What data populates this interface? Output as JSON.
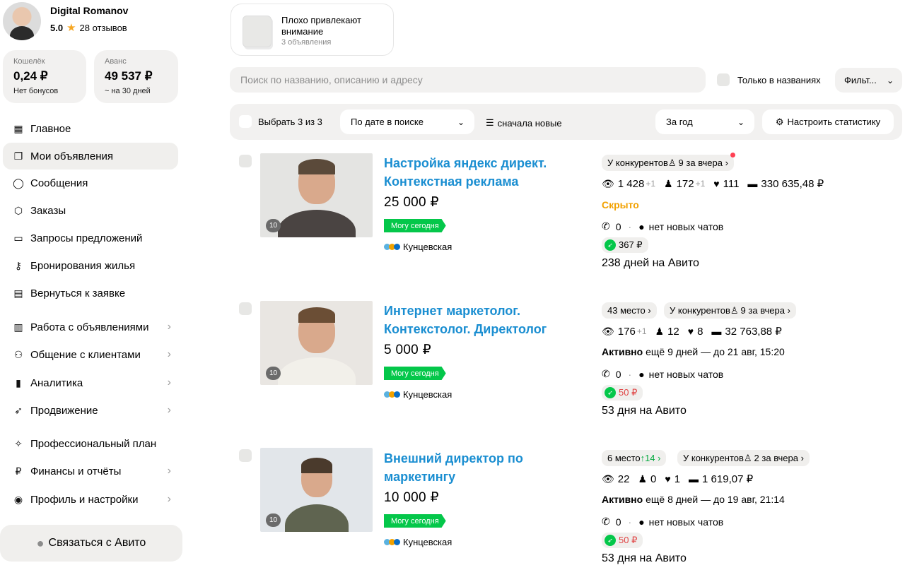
{
  "profile": {
    "name": "Digital Romanov",
    "rating": "5.0",
    "reviews": "28 отзывов"
  },
  "wallet": {
    "label": "Кошелёк",
    "value": "0,24 ₽",
    "sub": "Нет бонусов"
  },
  "advance": {
    "label": "Аванс",
    "value": "49 537 ₽",
    "sub": "~ на 30 дней"
  },
  "nav": [
    {
      "label": "Главное"
    },
    {
      "label": "Мои объявления"
    },
    {
      "label": "Сообщения"
    },
    {
      "label": "Заказы"
    },
    {
      "label": "Запросы предложений"
    },
    {
      "label": "Бронирования жилья"
    },
    {
      "label": "Вернуться к заявке"
    },
    {
      "label": "Работа с объявлениями"
    },
    {
      "label": "Общение с клиентами"
    },
    {
      "label": "Аналитика"
    },
    {
      "label": "Продвижение"
    },
    {
      "label": "Профессиональный план"
    },
    {
      "label": "Финансы и отчёты"
    },
    {
      "label": "Профиль и настройки"
    }
  ],
  "contact_label": "Связаться с Авито",
  "promo": {
    "title": "Плохо привлекают внимание",
    "sub": "3 объявления"
  },
  "search": {
    "placeholder": "Поиск по названию, описанию и адресу"
  },
  "only_names": "Только в названиях",
  "filters": "Фильт...",
  "toolbar": {
    "select": "Выбрать 3 из 3",
    "sort": "По дате в поиске",
    "order": "сначала новые",
    "period": "За год",
    "settings": "Настроить статистику"
  },
  "listings": [
    {
      "title": "Настройка яндекс директ. Контекстная реклама",
      "price": "25 000 ₽",
      "photos": "10",
      "badge": "Могу сегодня",
      "metro": "Кунцевская",
      "chips": [
        {
          "text": "У конкурентов ",
          "icon": "user-icon",
          "extra": "9 за вчера ›",
          "dot": true
        }
      ],
      "views": "1 428",
      "views_delta": "+1",
      "contacts": "172",
      "contacts_delta": "+1",
      "favs": "111",
      "spend": "330 635,48 ₽",
      "status": "Скрыто",
      "calls": "0",
      "chats": "нет новых чатов",
      "promo": "367 ₽",
      "days": "238 дней на Авито"
    },
    {
      "title": "Интернет маркетолог. Контекстолог. Директолог",
      "price": "5 000 ₽",
      "photos": "10",
      "badge": "Могу сегодня",
      "metro": "Кунцевская",
      "place": "43 место ›",
      "competitors": "У конкурентов ",
      "competitors_extra": "9 за вчера ›",
      "views": "176",
      "views_delta": "+1",
      "contacts": "12",
      "favs": "8",
      "spend": "32 763,88 ₽",
      "status_bold": "Активно",
      "status_rest": " ещё 9 дней — до 21 авг, 15:20",
      "calls": "0",
      "chats": "нет новых чатов",
      "promo": "50 ₽",
      "days": "53 дня на Авито"
    },
    {
      "title": "Внешний директор по маркетингу",
      "price": "10 000 ₽",
      "photos": "10",
      "badge": "Могу сегодня",
      "metro": "Кунцевская",
      "place": "6 место ",
      "place_delta": "↑14 ›",
      "competitors": "У конкурентов ",
      "competitors_extra": "2 за вчера ›",
      "views": "22",
      "contacts": "0",
      "favs": "1",
      "spend": "1 619,07 ₽",
      "status_bold": "Активно",
      "status_rest": " ещё 8 дней — до 19 авг, 21:14",
      "calls": "0",
      "chats": "нет новых чатов",
      "promo": "50 ₽",
      "days": "53 дня на Авито"
    }
  ],
  "colors": {
    "link": "#1a8ed1",
    "green": "#04c74a",
    "hidden": "#f2a100",
    "promo_red": "#e04545"
  }
}
